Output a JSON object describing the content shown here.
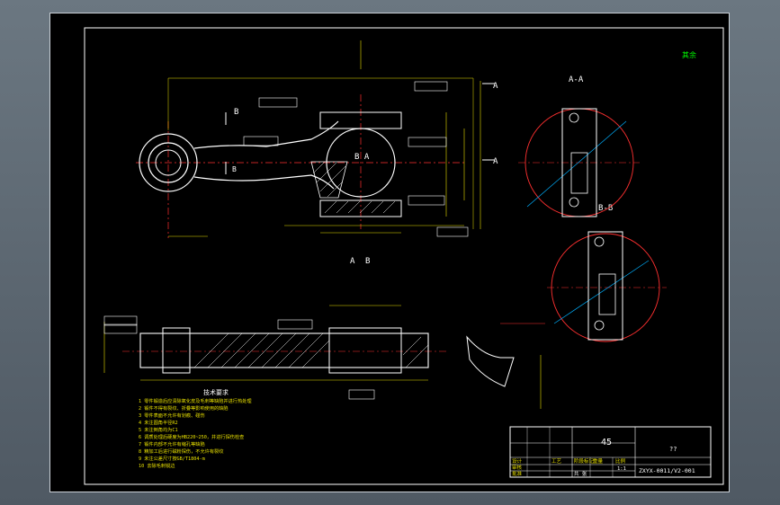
{
  "drawing": {
    "section_labels": {
      "a_a": "A-A",
      "b_b": "B-B",
      "ba": "B A",
      "a_mark": "A",
      "b_mark": "B",
      "a_bottom": "A",
      "b_bottom": "B",
      "b_side": "B",
      "b_left": "B"
    },
    "roughness_note": "其余",
    "notes_title": "技术要求",
    "notes": [
      "1 零件锻造后应清除氧化皮及毛刺等缺陷并进行热处理",
      "2 锻件不得有裂纹、折叠等影响使用的缺陷",
      "3 零件表面不允许有划痕、碰伤",
      "4 未注圆角半径R2",
      "5 未注倒角均为C1",
      "6 调质处理后硬度为HB220~250，并进行探伤检查",
      "7 锻件内部不允许有缩孔等缺陷",
      "8 精加工后进行磁粉探伤，不允许有裂纹",
      "9 未注公差尺寸按GB/T1804-m",
      "10 去除毛刺锐边"
    ],
    "title_block": {
      "material": "45",
      "drawing_no": "ZXYX-0011/V2-001",
      "top_right": "??",
      "scale": "1:1",
      "sheet": "共 张",
      "design": "设计",
      "check": "审核",
      "approve": "批准",
      "process": "工艺",
      "stage": "阶段标记",
      "weight": "重量",
      "ratio": "比例"
    }
  }
}
